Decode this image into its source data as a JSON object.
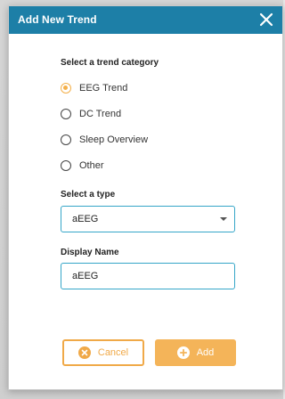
{
  "dialog": {
    "title": "Add New Trend",
    "close_icon": "close-icon"
  },
  "trend_category": {
    "label": "Select a trend category",
    "options": [
      {
        "label": "EEG Trend",
        "selected": true
      },
      {
        "label": "DC Trend",
        "selected": false
      },
      {
        "label": "Sleep Overview",
        "selected": false
      },
      {
        "label": "Other",
        "selected": false
      }
    ]
  },
  "type_select": {
    "label": "Select a type",
    "value": "aEEG"
  },
  "display_name": {
    "label": "Display Name",
    "value": "aEEG"
  },
  "buttons": {
    "cancel_label": "Cancel",
    "cancel_icon": "cancel-x-icon",
    "add_label": "Add",
    "add_icon": "plus-icon"
  },
  "colors": {
    "header": "#1d7fa7",
    "accent": "#f4b04a",
    "input_border": "#35a6c8"
  }
}
